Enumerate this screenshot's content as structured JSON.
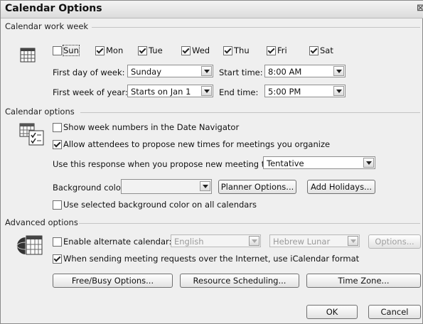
{
  "window": {
    "title": "Calendar Options",
    "close_glyph": "⊠"
  },
  "work_week": {
    "group_label": "Calendar work week",
    "days": [
      {
        "label": "Sun",
        "checked": false
      },
      {
        "label": "Mon",
        "checked": true
      },
      {
        "label": "Tue",
        "checked": true
      },
      {
        "label": "Wed",
        "checked": true
      },
      {
        "label": "Thu",
        "checked": true
      },
      {
        "label": "Fri",
        "checked": true
      },
      {
        "label": "Sat",
        "checked": true
      }
    ],
    "first_day_label": "First day of week:",
    "first_day_value": "Sunday",
    "start_time_label": "Start time:",
    "start_time_value": "8:00 AM",
    "first_week_label": "First week of year:",
    "first_week_value": "Starts on Jan 1",
    "end_time_label": "End time:",
    "end_time_value": "5:00 PM"
  },
  "calendar_options": {
    "group_label": "Calendar options",
    "show_week_numbers": {
      "label": "Show week numbers in the Date Navigator",
      "checked": false
    },
    "allow_propose": {
      "label": "Allow attendees to propose new times for meetings you organize",
      "checked": true
    },
    "response_label": "Use this response when you propose new meeting times:",
    "response_value": "Tentative",
    "bg_color_label": "Background color:",
    "bg_color_value": "",
    "planner_button": "Planner Options...",
    "holidays_button": "Add Holidays...",
    "use_selected_bg": {
      "label": "Use selected background color on all calendars",
      "checked": false
    }
  },
  "advanced": {
    "group_label": "Advanced options",
    "alt_calendar": {
      "label": "Enable alternate calendar:",
      "checked": false
    },
    "alt_language": "English",
    "alt_type": "Hebrew Lunar",
    "options_button": "Options...",
    "icalendar": {
      "label": "When sending meeting requests over the Internet, use iCalendar format",
      "checked": true
    },
    "freebusy_button": "Free/Busy Options...",
    "resource_button": "Resource Scheduling...",
    "timezone_button": "Time Zone..."
  },
  "footer": {
    "ok_button": "OK",
    "cancel_button": "Cancel"
  }
}
